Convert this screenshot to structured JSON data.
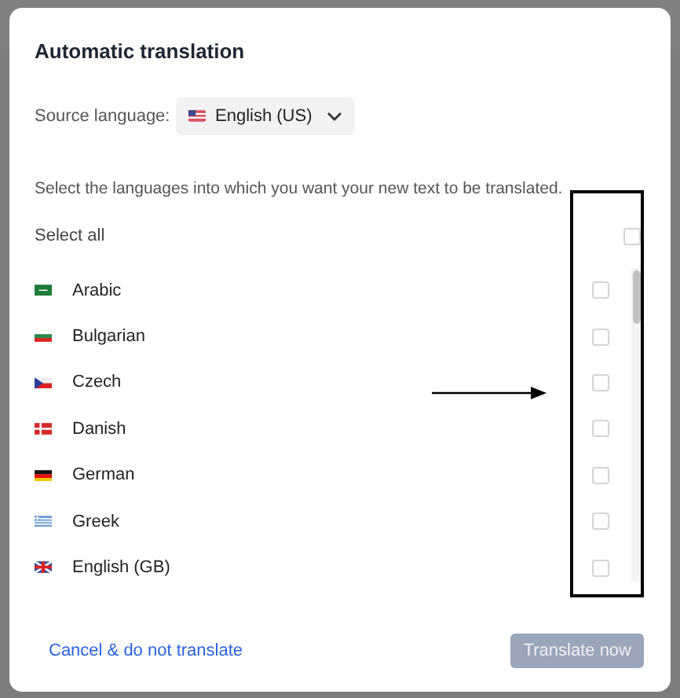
{
  "dialog": {
    "title": "Automatic translation",
    "source_language": {
      "label": "Source language:",
      "value": "English (US)",
      "kind": "us"
    },
    "instruction": "Select the languages into which you want your new text to be translated.",
    "select_all": {
      "label": "Select all",
      "checked": false
    },
    "languages": [
      {
        "name": "Arabic",
        "kind": "sa",
        "checked": false
      },
      {
        "name": "Bulgarian",
        "kind": "bg",
        "checked": false
      },
      {
        "name": "Czech",
        "kind": "cz",
        "checked": false
      },
      {
        "name": "Danish",
        "kind": "dk",
        "checked": false
      },
      {
        "name": "German",
        "kind": "de",
        "checked": false
      },
      {
        "name": "Greek",
        "kind": "gr",
        "checked": false
      },
      {
        "name": "English (GB)",
        "kind": "gb",
        "checked": false
      }
    ],
    "cancel_link": "Cancel & do not translate",
    "submit_button": {
      "label": "Translate now",
      "disabled": true
    }
  },
  "annotation": {
    "highlight_box": true,
    "arrow": true
  }
}
